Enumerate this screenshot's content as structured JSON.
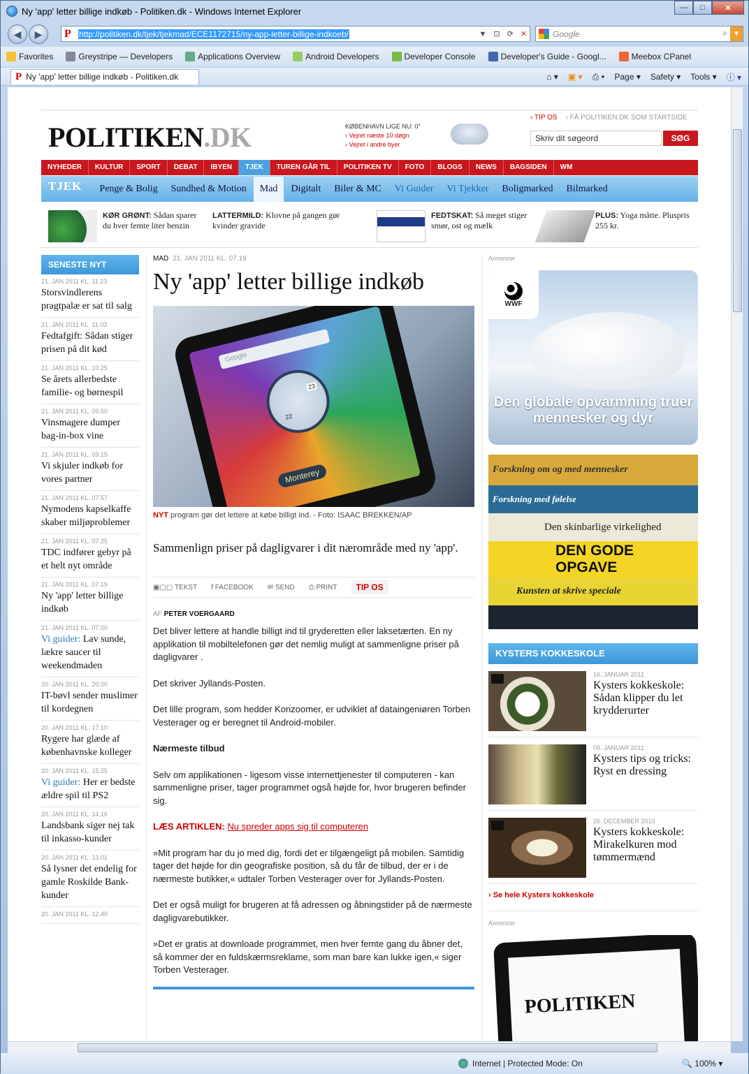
{
  "window": {
    "title": "Ny 'app' letter billige indkøb - Politiken.dk - Windows Internet Explorer",
    "address": "http://politiken.dk/tjek/tjekmad/ECE1172715/ny-app-letter-billige-indkoeb/",
    "search_placeholder": "Google",
    "tab_title": "Ny 'app' letter billige indkøb - Politiken.dk"
  },
  "favorites": {
    "label": "Favorites",
    "items": [
      "Greystripe — Developers",
      "Applications Overview",
      "Android Developers",
      "Developer Console",
      "Developer's Guide - Googl...",
      "Meebox CPanel"
    ]
  },
  "commands": {
    "page": "Page",
    "safety": "Safety",
    "tools": "Tools"
  },
  "status": {
    "zone": "Internet | Protected Mode: On",
    "zoom": "100%"
  },
  "site": {
    "logo_main": "POLITIKEN",
    "logo_dk": ".DK",
    "weather": {
      "title": "KØBENHAVN LIGE NU: 0°",
      "link1": "› Vejret næste 10 døgn",
      "link2": "› Vejret i andre byer"
    },
    "tipos": "› TIP OS",
    "startside": "› FÅ POLITIKEN.DK SOM STARTSIDE",
    "search_placeholder": "Skriv dit søgeord",
    "search_button": "SØG",
    "rednav": [
      "NYHEDER",
      "KULTUR",
      "SPORT",
      "DEBAT",
      "IBYEN",
      "TJEK",
      "TUREN GÅR TIL",
      "POLITIKEN TV",
      "FOTO",
      "BLOGS",
      "NEWS",
      "BAGSIDEN",
      "WM"
    ],
    "tjek_label": "TJEK",
    "bluenav": [
      "Penge & Bolig",
      "Sundhed & Motion",
      "Mad",
      "Digitalt",
      "Biler & MC",
      "Vi Guider",
      "Vi Tjekker",
      "Boligmarked",
      "Bilmarked"
    ],
    "promo": [
      {
        "kicker": "KØR GRØNT:",
        "text": " Sådan sparer du hver femte liter benzin"
      },
      {
        "kicker": "LATTERMILD:",
        "text": " Klovne på gangen gør kvinder gravide"
      },
      {
        "kicker": "FEDTSKAT:",
        "text": " Så meget stiger smør, ost og mælk"
      },
      {
        "kicker": "PLUS:",
        "text": " Yoga måtte. Pluspris 255 kr."
      }
    ]
  },
  "latest": {
    "heading": "SENESTE NYT",
    "items": [
      {
        "date": "21. JAN 2011 KL. 11.23",
        "title": "Storsvindlerens pragtpalæ er sat til salg"
      },
      {
        "date": "21. JAN 2011 KL. 11.03",
        "title": "Fedtafgift: Sådan stiger prisen på dit kød"
      },
      {
        "date": "21. JAN 2011 KL. 10.25",
        "title": "Se årets allerbedste familie- og børnespil"
      },
      {
        "date": "21. JAN 2011 KL. 09.50",
        "title": "Vinsmagere dumper bag-in-box vine"
      },
      {
        "date": "21. JAN 2011 KL. 09.15",
        "title": "Vi skjuler indkøb for vores partner"
      },
      {
        "date": "21. JAN 2011 KL. 07.57",
        "title": "Nymodens kapselkaffe skaber miljøproblemer"
      },
      {
        "date": "21. JAN 2011 KL. 07.25",
        "title": "TDC indfører gebyr på et helt nyt område"
      },
      {
        "date": "21. JAN 2011 KL. 07.19",
        "title": "Ny 'app' letter billige indkøb"
      },
      {
        "date": "21. JAN 2011 KL. 07.00",
        "prefix": "Vi guider:",
        "title": " Lav sunde, lækre saucer til weekendmaden"
      },
      {
        "date": "20. JAN 2011 KL. 20.00",
        "title": "IT-bøvl sender muslimer til kordegnen"
      },
      {
        "date": "20. JAN 2011 KL. 17.10",
        "title": "Rygere har glæde af københavnske kolleger"
      },
      {
        "date": "20. JAN 2011 KL. 15.25",
        "prefix": "Vi guider:",
        "title": " Her er bedste ældre spil til PS2"
      },
      {
        "date": "20. JAN 2011 KL. 14.16",
        "title": "Landsbank siger nej tak til inkasso-kunder"
      },
      {
        "date": "20. JAN 2011 KL. 13.01",
        "title": "Så lysner det endelig for gamle Roskilde Bank-kunder"
      },
      {
        "date": "20. JAN 2011 KL. 12.40",
        "title": ""
      }
    ]
  },
  "article": {
    "section": "MAD",
    "date": "21. JAN 2011 KL. 07.19",
    "title": "Ny 'app' letter billige indkøb",
    "caption_kicker": "NYT",
    "caption": " program gør det lettere at købe billigt ind. - Foto: ISAAC BREKKEN/AP",
    "lead": "Sammenlign priser på dagligvarer i dit nærområde med ny 'app'.",
    "tools": {
      "text": "TEKST",
      "facebook": "FACEBOOK",
      "send": "SEND",
      "print": "PRINT",
      "tipos": "TIP OS"
    },
    "byline_prefix": "AF",
    "author": "PETER VOERGAARD",
    "p1": "Det bliver lettere at handle billigt ind til gryderetten eller laksetærten. En ny applikation til mobiltelefonen gør det nemlig muligt at sammenligne priser på dagligvarer .",
    "p2": "Det skriver Jyllands-Posten.",
    "p3": "Det lille program, som hedder Konzoomer, er udviklet af dataingeniøren Torben Vesterager og er beregnet til Android-mobiler.",
    "sub": "Nærmeste tilbud",
    "p4": "Selv om applikationen - ligesom visse internettjenester til computeren - kan sammenligne priser, tager programmet også højde for, hvor brugeren befinder sig.",
    "laes": "LÆS ARTIKLEN:",
    "laes_link": "Nu spreder apps sig til computeren",
    "p5": "»Mit program har du jo med dig, fordi det er tilgængeligt på mobilen. Samtidig tager det højde for din geografiske position, så du får de tilbud, der er i de nærmeste butikker,« udtaler Torben Vesterager over for Jyllands-Posten.",
    "p6": "Det er også muligt for brugeren at få adressen og åbningstider på de nærmeste dagligvarebutikker.",
    "p7": "»Det er gratis at downloade programmet, men hver femte gang du åbner det, så kommer der en fuldskærmsreklame, som man bare kan lukke igen,« siger Torben Vesterager.",
    "phone": {
      "search": "Google",
      "city": "Monterey",
      "time": "22",
      "date": "23"
    }
  },
  "right": {
    "annon": "Annoncer",
    "wwf": "WWF",
    "ad1_text": "Den globale opvarmning truer mennesker og dyr",
    "books": [
      "Forskning om og med mennesker",
      "Forskning med følelse",
      "Den skinbarlige virkelighed",
      "DEN GODE OPGAVE",
      "Kunsten at skrive speciale"
    ],
    "kk_heading": "KYSTERS KOKKESKOLE",
    "kk_items": [
      {
        "date": "16. JANUAR 2011",
        "title": "Kysters kokkeskole: Sådan klipper du let krydderurter"
      },
      {
        "date": "09. JANUAR 2011",
        "title": "Kysters tips og tricks: Ryst en dressing"
      },
      {
        "date": "26. DECEMBER 2010",
        "title": "Kysters kokkeskole: Mirakelkuren mod tømmermænd"
      }
    ],
    "kk_all": "› Se hele Kysters kokkeskole",
    "annon2": "Annoncer",
    "ipad_logo": "POLITIKEN"
  }
}
